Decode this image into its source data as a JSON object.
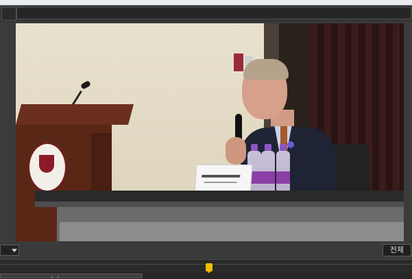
{
  "controls": {
    "view_all_label": "전체"
  },
  "icons": {
    "zoom_dropdown": "chevron-down-icon",
    "playhead": "playhead-marker-icon"
  },
  "colors": {
    "accent_playhead": "#f0c000",
    "panel_bg": "#3a3a3a"
  }
}
